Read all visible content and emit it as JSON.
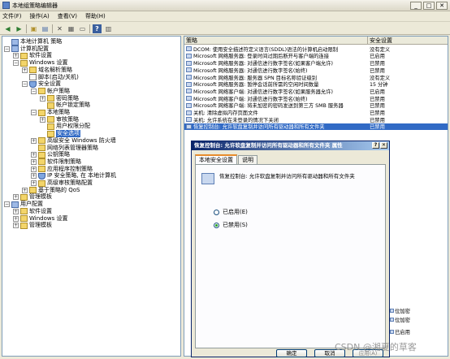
{
  "window": {
    "title": "本地组策略编辑器",
    "buttons": [
      "_",
      "□",
      "✕"
    ]
  },
  "menu": [
    "文件(F)",
    "操作(A)",
    "查看(V)",
    "帮助(H)"
  ],
  "tree": [
    {
      "label": "本地计算机 策略",
      "level": 0,
      "exp": "",
      "icon": "pc"
    },
    {
      "label": "计算机配置",
      "level": 0,
      "exp": "−",
      "icon": "pc"
    },
    {
      "label": "软件设置",
      "level": 1,
      "exp": "+",
      "icon": "folder"
    },
    {
      "label": "Windows 设置",
      "level": 1,
      "exp": "−",
      "icon": "folder"
    },
    {
      "label": "域名解析策略",
      "level": 2,
      "exp": "+",
      "icon": "folder"
    },
    {
      "label": "脚本(启动/关机)",
      "level": 2,
      "exp": "",
      "icon": "doc"
    },
    {
      "label": "安全设置",
      "level": 2,
      "exp": "−",
      "icon": "shield"
    },
    {
      "label": "帐户策略",
      "level": 3,
      "exp": "−",
      "icon": "folder"
    },
    {
      "label": "密码策略",
      "level": 4,
      "exp": "+",
      "icon": "folder"
    },
    {
      "label": "帐户锁定策略",
      "level": 4,
      "exp": "",
      "icon": "folder"
    },
    {
      "label": "本地策略",
      "level": 3,
      "exp": "−",
      "icon": "folder"
    },
    {
      "label": "审核策略",
      "level": 4,
      "exp": "+",
      "icon": "folder"
    },
    {
      "label": "用户权限分配",
      "level": 4,
      "exp": "",
      "icon": "folder"
    },
    {
      "label": "安全选项",
      "level": 4,
      "exp": "",
      "icon": "folder",
      "selected": true
    },
    {
      "label": "高级安全 Windows 防火墙",
      "level": 3,
      "exp": "+",
      "icon": "folder"
    },
    {
      "label": "网络列表管理器策略",
      "level": 3,
      "exp": "",
      "icon": "folder"
    },
    {
      "label": "公钥策略",
      "level": 3,
      "exp": "+",
      "icon": "folder"
    },
    {
      "label": "软件限制策略",
      "level": 3,
      "exp": "+",
      "icon": "folder"
    },
    {
      "label": "应用程序控制策略",
      "level": 3,
      "exp": "+",
      "icon": "folder"
    },
    {
      "label": "IP 安全策略, 在 本地计算机",
      "level": 3,
      "exp": "+",
      "icon": "shield"
    },
    {
      "label": "高级审核策略配置",
      "level": 3,
      "exp": "+",
      "icon": "folder"
    },
    {
      "label": "基于策略的 QoS",
      "level": 2,
      "exp": "+",
      "icon": "folder"
    },
    {
      "label": "管理模板",
      "level": 1,
      "exp": "+",
      "icon": "folder"
    },
    {
      "label": "用户配置",
      "level": 0,
      "exp": "−",
      "icon": "pc"
    },
    {
      "label": "软件设置",
      "level": 1,
      "exp": "+",
      "icon": "folder"
    },
    {
      "label": "Windows 设置",
      "level": 1,
      "exp": "+",
      "icon": "folder"
    },
    {
      "label": "管理模板",
      "level": 1,
      "exp": "+",
      "icon": "folder"
    }
  ],
  "list": {
    "headers": [
      "策略",
      "安全设置"
    ],
    "rows": [
      {
        "name": "DCOM: 使用安全描述符定义语言(SDDL)语法的计算机启动限制",
        "setting": "没有定义"
      },
      {
        "name": "Microsoft 网络服务器: 登录时间过期后断开与客户端的连接",
        "setting": "已启用"
      },
      {
        "name": "Microsoft 网络服务器: 对通信进行数字签名(如果客户端允许)",
        "setting": "已禁用"
      },
      {
        "name": "Microsoft 网络服务器: 对通信进行数字签名(始终)",
        "setting": "已禁用"
      },
      {
        "name": "Microsoft 网络服务器: 服务器 SPN 目标名称验证级别",
        "setting": "没有定义"
      },
      {
        "name": "Microsoft 网络服务器: 暂停会话前所需的空闲时间数量",
        "setting": "15 分钟"
      },
      {
        "name": "Microsoft 网络客户端: 对通信进行数字签名(如果服务器允许)",
        "setting": "已启用"
      },
      {
        "name": "Microsoft 网络客户端: 对通信进行数字签名(始终)",
        "setting": "已禁用"
      },
      {
        "name": "Microsoft 网络客户端: 将未加密的密码发送到第三方 SMB 服务器",
        "setting": "已禁用"
      },
      {
        "name": "关机: 清除虚拟内存页面文件",
        "setting": "已禁用"
      },
      {
        "name": "关机: 允许系统在未登录的情况下关闭",
        "setting": "已禁用"
      },
      {
        "name": "恢复控制台: 允许软盘复制并访问所有驱动器和所有文件夹",
        "setting": "已禁用",
        "selected": true
      }
    ]
  },
  "right_partial": [
    "位加密",
    "位加密",
    "已启用"
  ],
  "dialog": {
    "title": "恢复控制台: 允许软盘复制并访问所有驱动器和所有文件夹 属性",
    "title_buttons": [
      "?",
      "✕"
    ],
    "tabs": [
      "本地安全设置",
      "说明"
    ],
    "policy_text": "恢复控制台: 允许软盘复制并访问所有驱动器和所有文件夹",
    "options": [
      {
        "label": "已启用(E)",
        "checked": false
      },
      {
        "label": "已禁用(S)",
        "checked": true
      }
    ],
    "buttons": [
      "确定",
      "取消",
      "应用(A)"
    ]
  },
  "watermark": "CSDN @湘夏的草客"
}
